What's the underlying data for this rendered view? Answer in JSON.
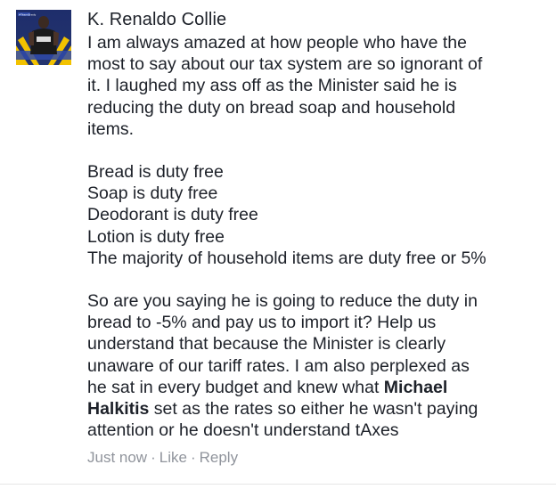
{
  "comment": {
    "author": "K. Renaldo Collie",
    "avatar_text": "#TeamBrady",
    "paragraph1": [
      "I am always amazed at how people who have the",
      "most to say about our tax system are so ignorant of",
      "it. I laughed my ass off as the Minister said he is",
      "reducing the duty on bread soap and household",
      "items."
    ],
    "list": [
      "Bread is duty free",
      "Soap is duty free",
      "Deodorant is duty free",
      "Lotion is duty free",
      "The majority of household items are duty free or 5%"
    ],
    "paragraph3": [
      "So are you saying he is going to reduce the duty in",
      "bread to -5% and pay us to import it? Help us",
      "understand that because the Minister is clearly",
      "unaware of our tariff rates. I am also perplexed as"
    ],
    "p3_line5_pre": "he sat in every budget and knew what ",
    "p3_line5_bold": "Michael",
    "p3_line6_bold": "Halkitis",
    "p3_line6_post": " set as the rates so either he wasn't paying",
    "p3_line7": "attention or he doesn't understand tAxes",
    "timestamp": "Just now",
    "separator": "·",
    "like_label": "Like",
    "reply_label": "Reply"
  }
}
